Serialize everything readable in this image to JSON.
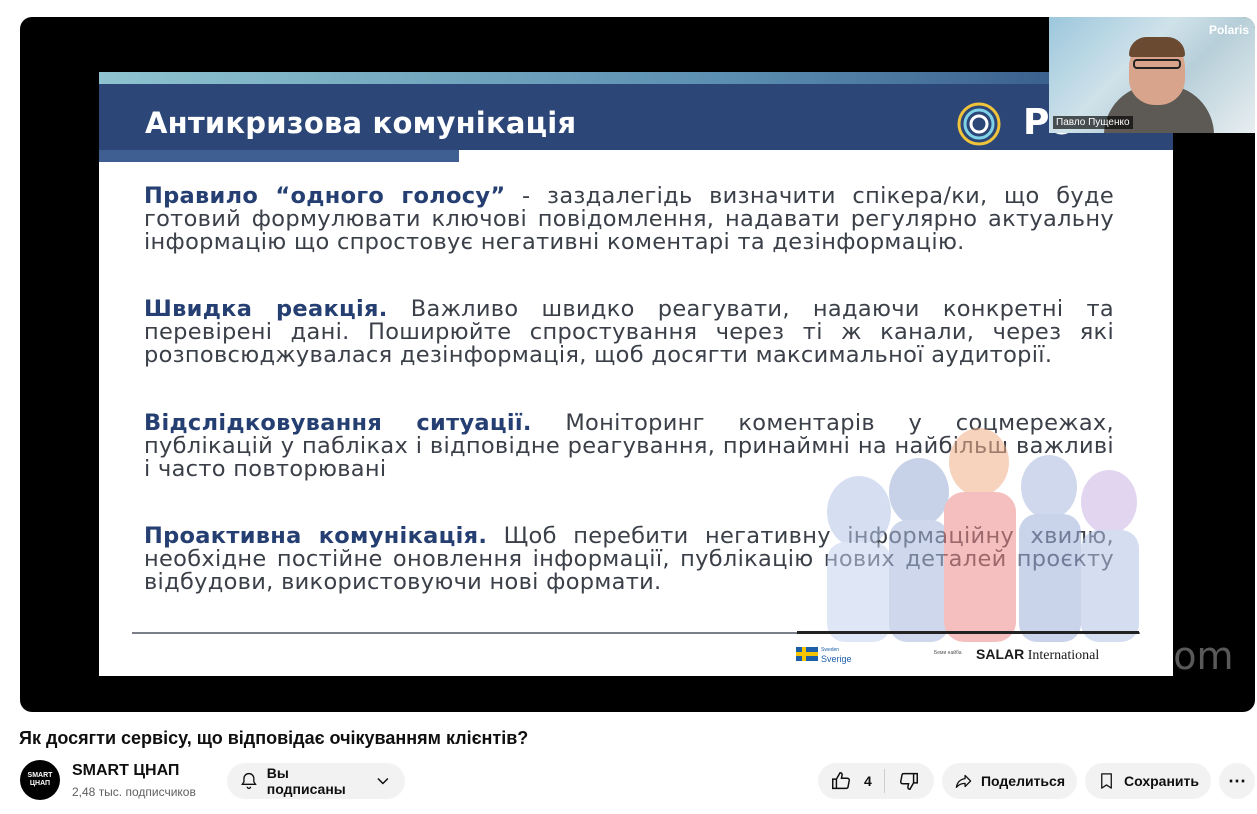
{
  "slide": {
    "title": "Антикризова комунікація",
    "brand_text": "Po",
    "paragraphs": [
      {
        "heading": "Правило “одного голосу”",
        "body": " - заздалегідь визначити спікера/ки, що буде готовий формулювати ключові повідомлення, надавати регулярно актуальну інформацію що спростовує негативні коментарі та дезінформацію."
      },
      {
        "heading": "Швидка реакція.",
        "body": " Важливо швидко реагувати, надаючи конкретні та перевірені дані. Поширюйте спростування через ті ж канали, через які розповсюджувалася дезінформація, щоб досягти максимальної аудиторії."
      },
      {
        "heading": "Відслідковування ситуації.",
        "body": " Моніторинг коментарів у соцмережах, публікацій у пабліках і відповідне реагування, принаймні на найбільш важливі і часто повторювані"
      },
      {
        "heading": "Проактивна комунікація.",
        "body": " Щоб перебити негативну інформаційну хвилю, необхідне постійне оновлення інформації, публікацію нових деталей проєкту відбудови, використовуючи нові формати."
      }
    ],
    "footer": {
      "sverige_top": "Sweden",
      "sverige": "Sverige",
      "small_text": "Беми найба",
      "salar": "SALAR",
      "international": "International"
    }
  },
  "player": {
    "zoom_watermark": "zoom",
    "webcam": {
      "brand": "Polaris",
      "name": "Павло Пущенко"
    }
  },
  "video": {
    "title": "Як досягти сервісу, що відповідає очікуванням клієнтів?"
  },
  "channel": {
    "avatar_line1": "SMART",
    "avatar_line2": "ЦНАП",
    "name": "SMART ЦНАП",
    "subscribers": "2,48 тыс. подписчиков"
  },
  "actions": {
    "subscribe_label": "Вы подписаны",
    "like_count": "4",
    "share_label": "Поделиться",
    "save_label": "Сохранить",
    "more_label": "⋯"
  },
  "icons": [
    "bell-icon",
    "chevron-down-icon",
    "thumbs-up-icon",
    "thumbs-down-icon",
    "share-icon",
    "save-icon",
    "more-icon"
  ]
}
